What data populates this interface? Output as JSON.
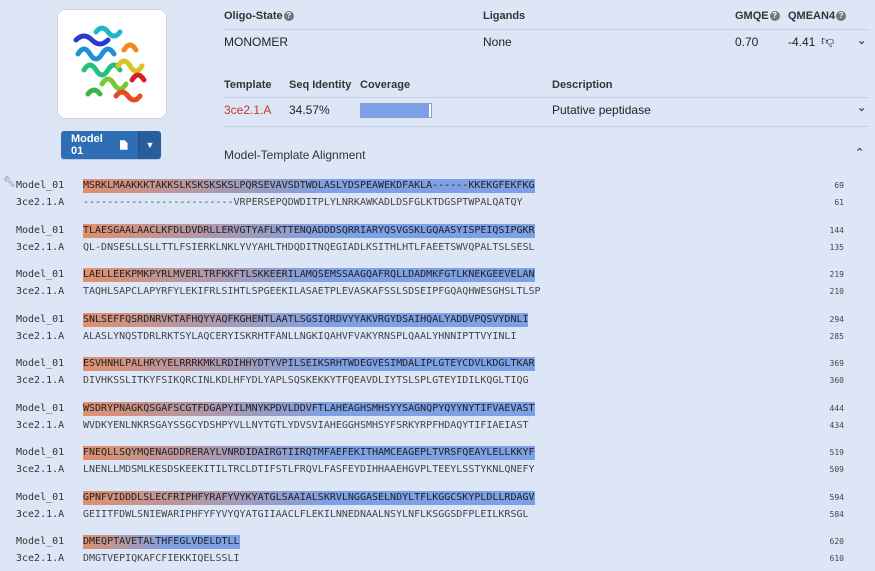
{
  "header": {
    "oligo_label": "Oligo-State",
    "ligands_label": "Ligands",
    "gmqe_label": "GMQE",
    "qmean_label": "QMEAN4",
    "oligo_value": "MONOMER",
    "ligands_value": "None",
    "gmqe_value": "0.70",
    "qmean_value": "-4.41"
  },
  "template_table": {
    "template_label": "Template",
    "seq_identity_label": "Seq Identity",
    "coverage_label": "Coverage",
    "description_label": "Description",
    "template_value": "3ce2.1.A",
    "seq_identity_value": "34.57%",
    "coverage_fraction": 0.97,
    "description_value": "Putative peptidase"
  },
  "model_button": {
    "label": "Model 01"
  },
  "alignment": {
    "title": "Model-Template Alignment",
    "model_name": "Model_01",
    "template_name": "3ce2.1.A",
    "blocks": [
      {
        "model": "MSRKLMAAKKKTAKKSLKSKSKSKSLPQRSEVAVSDTWDLASLYDSPEAWEKDFAKLA------KKEKGFEKFKG",
        "template": "-------------------------VRPERSEPQDWDITPLYLNRKAWKADLDSFGLKTDGSPTWPALQATQY",
        "mnum": "69",
        "tnum": "61"
      },
      {
        "model": "TLAESGAALAACLKFDLDVDRLLERVGTYAFLKTTENQADDDSQRRIARYQSVGSKLGQAASYISPEIQSIPGKR",
        "template": "QL-DNSESLLSLLTTLFSIERKLNKLYVYAHLTHDQDITNQEGIADLKSITHLHTLFAEETSWVQPALTSLSESL",
        "mnum": "144",
        "tnum": "135"
      },
      {
        "model": "LAELLEEKPMKPYRLMVERLTRFKKFTLSKKEERILAMQSEMSSAAGQAFRQLLDADMKFGTLKNEKGEEVELAN",
        "template": "TAQHLSAPCLAPYRFYLEKIFRLSIHTLSPGEEKILASAETPLEVASKAFSSLSDSEIPFGQAQHWESGHSLTLSP",
        "mnum": "219",
        "tnum": "210"
      },
      {
        "model": "SNLSEFFQSRDNRVKTAFHQYYAQFKGHENTLAATLSGSIQRDVYYAKVRGYDSAIHQALYADDVPQSVYDNLI",
        "template": "ALASLYNQSTDRLRKTSYLAQCERYISKRHTFANLLNGKIQAHVFVAKYRNSPLQAALYHNNIPTTVYINLI",
        "mnum": "294",
        "tnum": "285"
      },
      {
        "model": "ESVHNHLPALHRYYELRRRKMKLRDIHHYDTYVPILSEIKSRHTWDEGVESIMDALIPLGTEYCDVLKDGLTKAR",
        "template": "DIVHKSSLITKYFSIKQRCINLKDLHFYDLYAPLSQSKEKKYTFQEAVDLIYTSLSPLGTEYIDILKQGLTIQG",
        "mnum": "369",
        "tnum": "360"
      },
      {
        "model": "WSDRYPNAGKQSGAFSCGTFDGAPYILMNYKPDVLDDVFTLAHEAGHSMHSYYSAGNQPYQYYNYTIFVAEVAST",
        "template": "WVDKYENLNKRSGAYSSGCYDSHPYVLLNYTGTLYDVSVIAHEGGHSMHSYFSRKYRPFHDAQYTIFIAEIAST",
        "mnum": "444",
        "tnum": "434"
      },
      {
        "model": "FNEQLLSQYMQENAGDDRERAYLVNRDIDAIRGTIIRQTMFAEFEKITHAMCEAGEPLTVRSFQEAYLELLKKYF",
        "template": "LNENLLMDSMLKESDSKEEKITILTRCLDTIFSTLFRQVLFASFEYDIHHAAEHGVPLTEEYLSSTYKNLQNEFY",
        "mnum": "519",
        "tnum": "509"
      },
      {
        "model": "GPNFVIDDDLSLECFRIPHFYRAFYVYKYATGLSAAIALSKRVLNGGASELNDYLTFLKGGCSKYPLDLLRDAGV",
        "template": "GEIITFDWLSNIEWARIPHFYFYVYQYATGIIAACLFLEKILNNEDNAALNSYLNFLKSGGSDFPLEILKRSGL",
        "mnum": "594",
        "tnum": "584"
      },
      {
        "model": "DMEQPTAVETALTHFEGLVDELDTLL",
        "template": "DMGTVEPIQKAFCFIEKKIQELSSLI",
        "mnum": "620",
        "tnum": "610"
      }
    ]
  },
  "colors": {
    "background": "#dde6f7",
    "accent": "#2f6db4",
    "template_link": "#c0392b",
    "helix": "#7ea1e6",
    "loop": "#e0906e"
  },
  "icons": [
    "info-icon",
    "thumbs-down-icon",
    "chevron-down-icon",
    "chevron-up-icon",
    "document-icon",
    "caret-down-icon",
    "wrench-icon"
  ]
}
